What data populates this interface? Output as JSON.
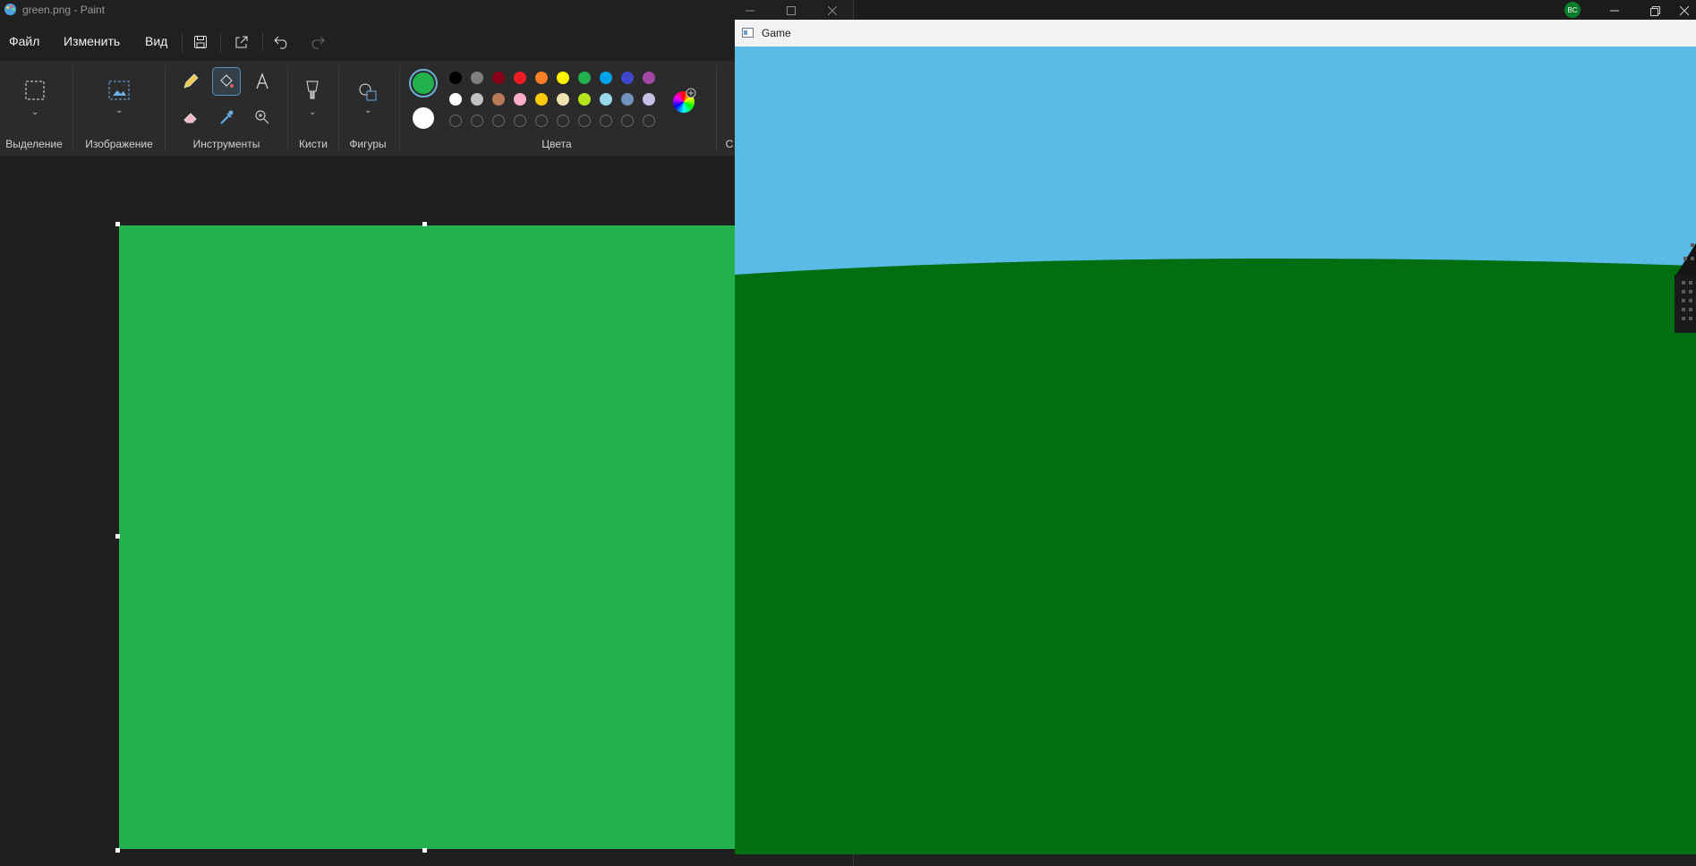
{
  "paint": {
    "window_title": "green.png - Paint",
    "menu": {
      "file": "Файл",
      "edit": "Изменить",
      "view": "Вид"
    },
    "groups": {
      "selection": "Выделение",
      "image": "Изображение",
      "tools": "Инструменты",
      "brushes": "Кисти",
      "shapes": "Фигуры",
      "colors": "Цвета",
      "layers_partial": "С"
    },
    "primary_color": "#22b14c",
    "secondary_color": "#ffffff",
    "palette_row1": [
      "#000000",
      "#7f7f7f",
      "#880015",
      "#ed1c24",
      "#ff7f27",
      "#fff200",
      "#22b14c",
      "#00a2e8",
      "#3f48cc",
      "#a349a4"
    ],
    "palette_row2": [
      "#ffffff",
      "#c3c3c3",
      "#b97a57",
      "#ffaec9",
      "#ffc90e",
      "#efe4b0",
      "#b5e61d",
      "#99d9ea",
      "#7092be",
      "#c8bfe7"
    ],
    "canvas_color": "#22b14c"
  },
  "game": {
    "window_title": "Game",
    "sky_color": "#5abbe6",
    "ground_color": "#016e12"
  },
  "back_window": {
    "avatar_text": "BC"
  }
}
